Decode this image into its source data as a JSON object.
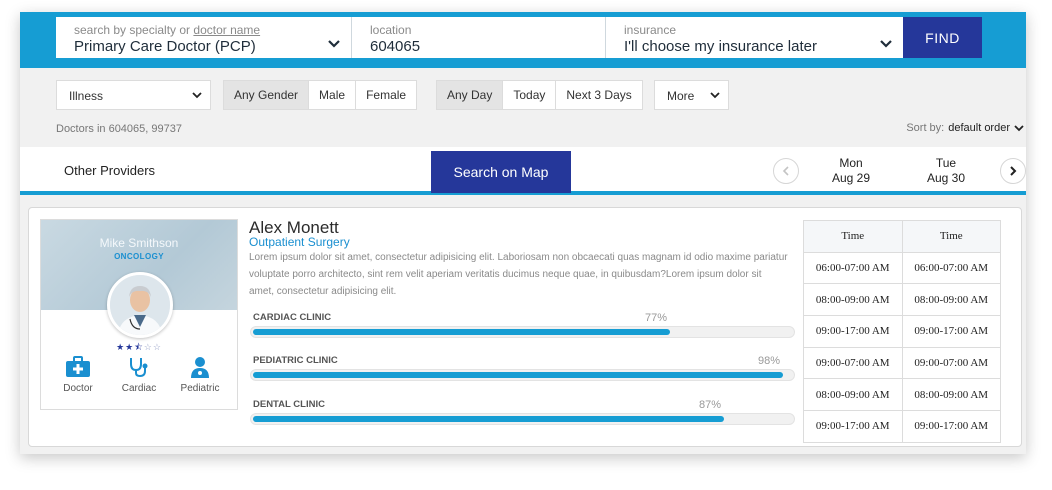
{
  "search": {
    "specialty_label_prefix": "search by specialty or ",
    "specialty_label_link": "doctor name",
    "specialty_value": "Primary Care Doctor (PCP)",
    "location_label": "location",
    "location_value": "604065",
    "insurance_label": "insurance",
    "insurance_value": "I'll choose my insurance later",
    "find_label": "FIND"
  },
  "filters": {
    "illness_label": "Illness",
    "gender": [
      "Any Gender",
      "Male",
      "Female"
    ],
    "day": [
      "Any Day",
      "Today",
      "Next 3 Days"
    ],
    "more_label": "More",
    "doctors_in": "Doctors in 604065, 99737",
    "sort_prefix": "Sort by:",
    "sort_value": "default order"
  },
  "providers": {
    "other_label": "Other Providers",
    "map_button": "Search on Map",
    "days": [
      {
        "dow": "Mon",
        "date": "Aug 29"
      },
      {
        "dow": "Tue",
        "date": "Aug 30"
      }
    ]
  },
  "profile": {
    "banner_name": "Mike Smithson",
    "banner_specialty": "ONCOLOGY",
    "rating": {
      "filled": 2,
      "half": 1,
      "empty": 2
    },
    "icons": [
      {
        "name": "doctor-bag-icon",
        "label": "Doctor"
      },
      {
        "name": "stethoscope-icon",
        "label": "Cardiac"
      },
      {
        "name": "pediatric-icon",
        "label": "Pediatric"
      }
    ],
    "name": "Alex Monett",
    "subtitle": "Outpatient Surgery",
    "description": "Lorem ipsum dolor sit amet, consectetur adipisicing elit. Laboriosam non obcaecati quas magnam id odio maxime pariatur voluptate porro architecto, sint rem velit aperiam veritatis ducimus neque quae, in quibusdam?Lorem ipsum dolor sit amet, consectetur adipisicing elit.",
    "skills": [
      {
        "label": "CARDIAC CLINIC",
        "pct_text": "77%",
        "value": 0.77
      },
      {
        "label": "PEDIATRIC CLINIC",
        "pct_text": "98%",
        "value": 0.98
      },
      {
        "label": "DENTAL CLINIC",
        "pct_text": "87%",
        "value": 0.87
      }
    ]
  },
  "times": {
    "headers": [
      "Time",
      "Time"
    ],
    "rows": [
      [
        "06:00-07:00 AM",
        "06:00-07:00 AM"
      ],
      [
        "08:00-09:00 AM",
        "08:00-09:00 AM"
      ],
      [
        "09:00-17:00 AM",
        "09:00-17:00 AM"
      ],
      [
        "09:00-07:00 AM",
        "09:00-07:00 AM"
      ],
      [
        "08:00-09:00 AM",
        "08:00-09:00 AM"
      ],
      [
        "09:00-17:00 AM",
        "09:00-17:00 AM"
      ]
    ]
  },
  "colors": {
    "accent_blue": "#169dd3",
    "navy": "#25379a"
  }
}
